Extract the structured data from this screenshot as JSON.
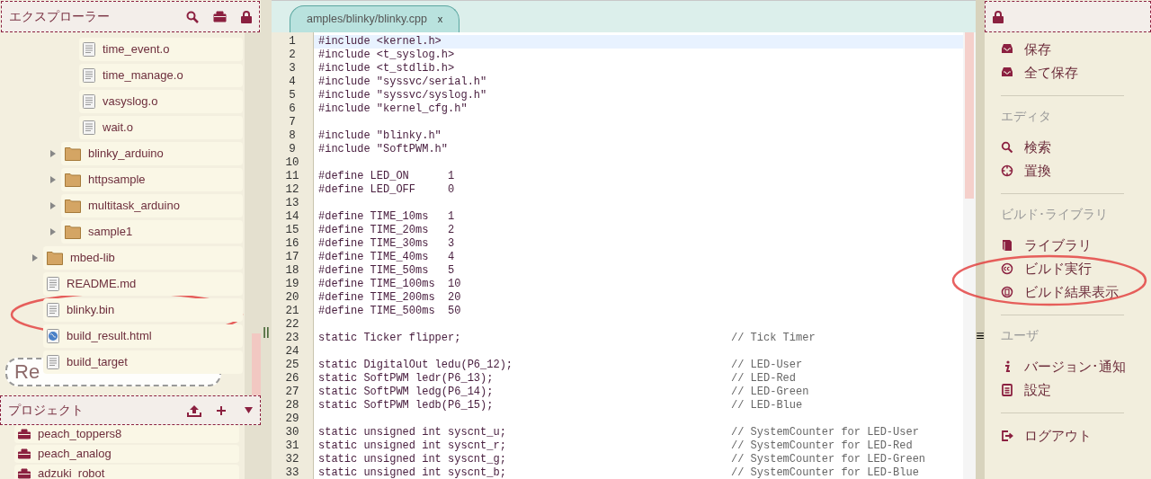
{
  "explorer": {
    "title": "エクスプローラー",
    "tree": [
      {
        "children": [
          {
            "children": [
              {
                "kind": "file",
                "name": "time_event.o"
              },
              {
                "kind": "file",
                "name": "time_manage.o"
              },
              {
                "kind": "file",
                "name": "vasyslog.o"
              },
              {
                "kind": "file",
                "name": "wait.o"
              }
            ]
          },
          {
            "kind": "folder",
            "name": "blinky_arduino",
            "expanded": false
          },
          {
            "kind": "folder",
            "name": "httpsample",
            "expanded": false
          },
          {
            "kind": "folder",
            "name": "multitask_arduino",
            "expanded": false
          },
          {
            "kind": "folder",
            "name": "sample1",
            "expanded": false
          }
        ]
      },
      {
        "kind": "folder",
        "name": "mbed-lib",
        "expanded": false
      },
      {
        "kind": "file",
        "name": "README.md"
      },
      {
        "kind": "file",
        "name": "blinky.bin"
      },
      {
        "kind": "web",
        "name": "build_result.html"
      },
      {
        "kind": "file",
        "name": "build_target"
      }
    ],
    "stamp": "Re"
  },
  "project": {
    "title": "プロジェクト",
    "items": [
      "peach_toppers8",
      "peach_analog",
      "adzuki_robot"
    ]
  },
  "editor": {
    "tabs": [
      {
        "label": "amples/blinky/blinky.cpp",
        "close": "x",
        "selected": true
      }
    ],
    "lines": [
      {
        "n": "1",
        "code": "#include <kernel.h>",
        "current": true
      },
      {
        "n": "2",
        "code": "#include <t_syslog.h>"
      },
      {
        "n": "3",
        "code": "#include <t_stdlib.h>"
      },
      {
        "n": "4",
        "code": "#include \"syssvc/serial.h\""
      },
      {
        "n": "5",
        "code": "#include \"syssvc/syslog.h\""
      },
      {
        "n": "6",
        "code": "#include \"kernel_cfg.h\""
      },
      {
        "n": "7"
      },
      {
        "n": "8",
        "code": "#include \"blinky.h\""
      },
      {
        "n": "9",
        "code": "#include \"SoftPWM.h\""
      },
      {
        "n": "10"
      },
      {
        "n": "11",
        "code": "#define LED_ON      1"
      },
      {
        "n": "12",
        "code": "#define LED_OFF     0"
      },
      {
        "n": "13"
      },
      {
        "n": "14",
        "code": "#define TIME_10ms   1"
      },
      {
        "n": "15",
        "code": "#define TIME_20ms   2"
      },
      {
        "n": "16",
        "code": "#define TIME_30ms   3"
      },
      {
        "n": "17",
        "code": "#define TIME_40ms   4"
      },
      {
        "n": "18",
        "code": "#define TIME_50ms   5"
      },
      {
        "n": "19",
        "code": "#define TIME_100ms  10"
      },
      {
        "n": "20",
        "code": "#define TIME_200ms  20"
      },
      {
        "n": "21",
        "code": "#define TIME_500ms  50"
      },
      {
        "n": "22"
      },
      {
        "n": "23",
        "code": "static Ticker flipper;",
        "comment": "// Tick Timer"
      },
      {
        "n": "24"
      },
      {
        "n": "25",
        "code": "static DigitalOut ledu(P6_12);",
        "comment": "// LED-User"
      },
      {
        "n": "26",
        "code": "static SoftPWM ledr(P6_13);",
        "comment": "// LED-Red"
      },
      {
        "n": "27",
        "code": "static SoftPWM ledg(P6_14);",
        "comment": "// LED-Green"
      },
      {
        "n": "28",
        "code": "static SoftPWM ledb(P6_15);",
        "comment": "// LED-Blue"
      },
      {
        "n": "29"
      },
      {
        "n": "30",
        "code": "static unsigned int syscnt_u;",
        "comment": "// SystemCounter for LED-User"
      },
      {
        "n": "31",
        "code": "static unsigned int syscnt_r;",
        "comment": "// SystemCounter for LED-Red"
      },
      {
        "n": "32",
        "code": "static unsigned int syscnt_g;",
        "comment": "// SystemCounter for LED-Green"
      },
      {
        "n": "33",
        "code": "static unsigned int syscnt_b;",
        "comment": "// SystemCounter for LED-Blue"
      }
    ]
  },
  "splitter": "||",
  "menu_toggle": "≡",
  "menu": {
    "groups": [
      {
        "items": [
          {
            "kind": "save",
            "label": "保存"
          },
          {
            "kind": "save",
            "label": "全て保存"
          }
        ]
      },
      {
        "heading": "エディタ",
        "items": [
          {
            "kind": "search",
            "label": "検索"
          },
          {
            "kind": "replace",
            "label": "置換"
          }
        ]
      },
      {
        "heading": "ビルド･ライブラリ",
        "items": [
          {
            "kind": "library",
            "label": "ライブラリ"
          },
          {
            "kind": "build",
            "label": "ビルド実行"
          },
          {
            "kind": "result",
            "label": "ビルド結果表示"
          }
        ]
      },
      {
        "heading": "ユーザ",
        "items": [
          {
            "kind": "info",
            "label": "バージョン･通知"
          },
          {
            "kind": "settings",
            "label": "設定"
          }
        ]
      },
      {
        "items": [
          {
            "kind": "logout",
            "label": "ログアウト"
          }
        ]
      }
    ]
  }
}
